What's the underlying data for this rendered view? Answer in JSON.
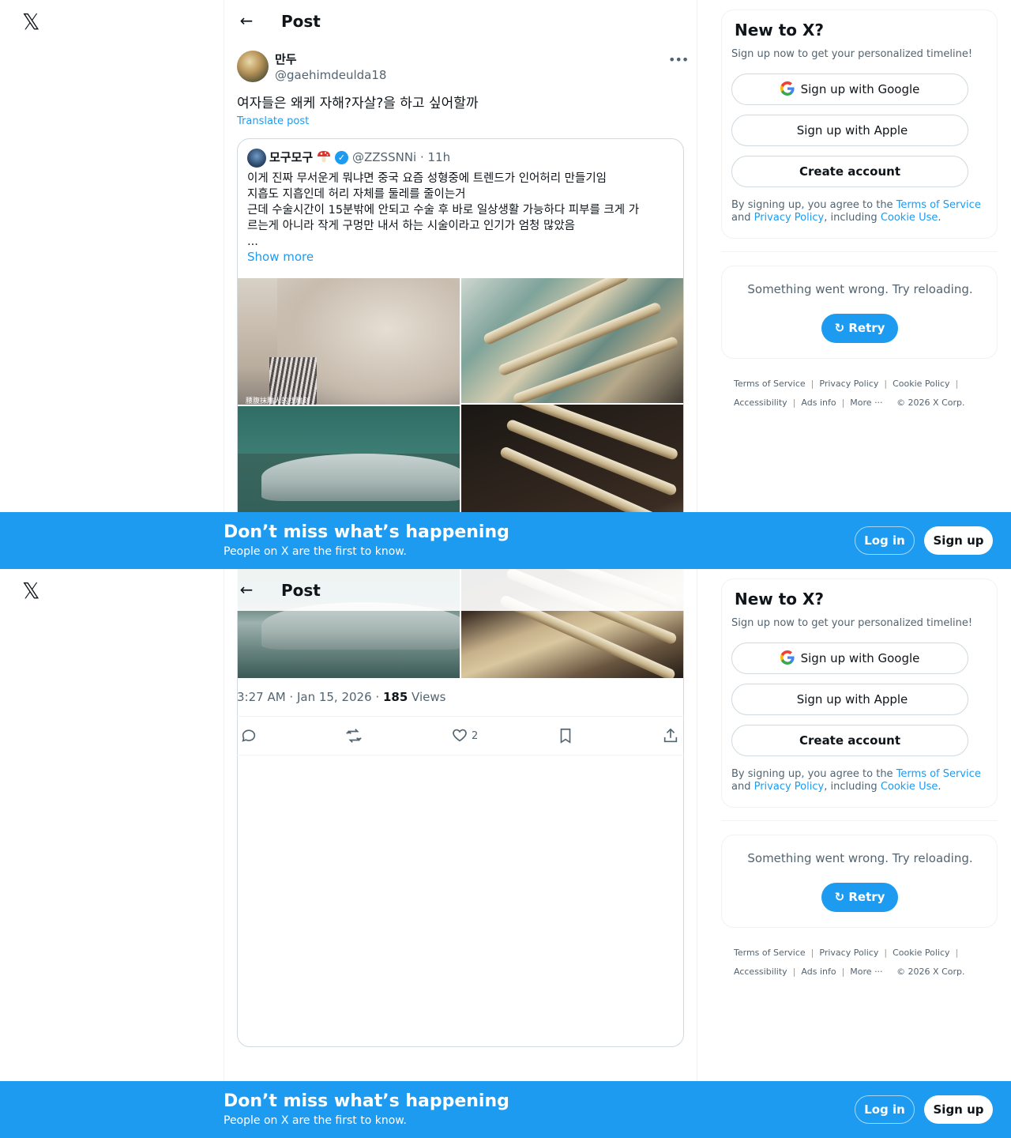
{
  "header": {
    "title": "Post"
  },
  "post": {
    "author_name": "만두",
    "author_handle": "@gaehimdeulda18",
    "text": "여자들은 왜케 자해?자살?을 하고 싶어할까",
    "translate_label": "Translate post",
    "quote": {
      "name": "모구모구",
      "handle_time": "@ZZSSNNi · 11h",
      "lines": [
        "이게 진짜 무서운게 뭐냐면 중국 요즘 성형중에 트렌드가 인어허리 만들기임",
        "지흡도 지흡인데 허리 자체를 둘레를 줄이는거",
        "근데 수술시간이 15분밖에 안되고 수술 후 바로 일상생활 가능하다 피부를 크게 가",
        "르는게 아니라 작게 구멍만 내서 하는 시술이라고 인기가 엄청 많았음",
        "..."
      ],
      "show_more": "Show more",
      "image_caption": "腰腹抹雕人的找雕刻"
    },
    "time": "3:27 AM · Jan 15, 2026 · ",
    "views_count": "185",
    "views_label": " Views",
    "likes": "2"
  },
  "sidebar": {
    "title": "New to X?",
    "subtitle": "Sign up now to get your personalized timeline!",
    "google_label": "Sign up with Google",
    "apple_label": "Sign up with Apple",
    "create_label": "Create account",
    "legal_prefix": "By signing up, you agree to the ",
    "terms_link": "Terms of Service",
    "legal_and": " and ",
    "privacy_link": "Privacy Policy",
    "legal_including": ", including ",
    "cookie_link": "Cookie Use",
    "legal_end": ".",
    "error_text": "Something went wrong. Try reloading.",
    "retry_label": "Retry"
  },
  "footer": {
    "terms": "Terms of Service",
    "privacy": "Privacy Policy",
    "cookie": "Cookie Policy",
    "accessibility": "Accessibility",
    "ads": "Ads info",
    "more": "More ···",
    "copyright": "© 2026 X Corp."
  },
  "banner": {
    "title": "Don’t miss what’s happening",
    "subtitle": "People on X are the first to know.",
    "login": "Log in",
    "signup": "Sign up"
  },
  "colors": {
    "accent": "#1d9bf0",
    "text": "#0f1419",
    "muted": "#536471"
  },
  "icons": [
    "x-logo-icon",
    "back-arrow-icon",
    "more-icon",
    "verified-icon",
    "mushroom-emoji-icon",
    "google-icon",
    "apple-icon",
    "reply-icon",
    "repost-icon",
    "like-icon",
    "bookmark-icon",
    "share-icon",
    "retry-icon"
  ]
}
